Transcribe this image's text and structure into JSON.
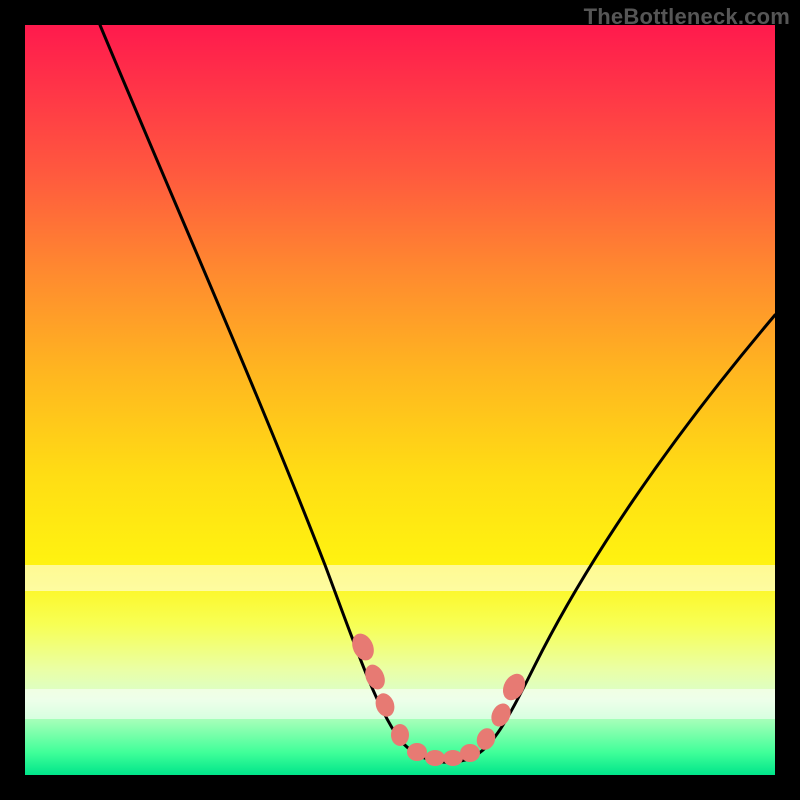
{
  "watermark": "TheBottleneck.com",
  "chart_data": {
    "type": "line",
    "title": "",
    "xlabel": "",
    "ylabel": "",
    "xlim": [
      0,
      100
    ],
    "ylim": [
      0,
      100
    ],
    "series": [
      {
        "name": "curve",
        "x": [
          10,
          15,
          20,
          25,
          30,
          35,
          40,
          44,
          46,
          48,
          50,
          52,
          54,
          56,
          58,
          60,
          64,
          70,
          78,
          88,
          100
        ],
        "values": [
          100,
          90,
          79,
          67,
          55,
          43,
          31,
          20,
          15,
          10,
          7,
          5,
          4,
          4,
          4,
          5,
          8,
          14,
          25,
          40,
          61
        ]
      }
    ],
    "markers": {
      "name": "highlight-points",
      "x": [
        45,
        46.5,
        48,
        50,
        52,
        54,
        56,
        58,
        60,
        62,
        63.5
      ],
      "values": [
        17,
        13.5,
        10,
        7,
        5,
        4,
        4,
        4,
        5,
        7,
        9.5
      ]
    },
    "background_stops": [
      {
        "pos": 0,
        "color": "#ff1a4d"
      },
      {
        "pos": 50,
        "color": "#ffdd14"
      },
      {
        "pos": 100,
        "color": "#00e58a"
      }
    ],
    "white_bands_y": [
      72,
      90
    ]
  }
}
